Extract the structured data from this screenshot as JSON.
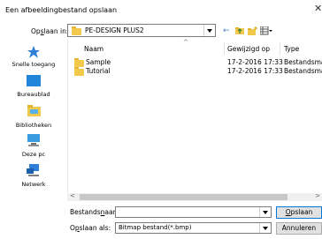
{
  "window": {
    "title": "Een afbeeldingbestand opslaan"
  },
  "toolbar": {
    "save_in_label_pre": "Op",
    "save_in_label_u": "s",
    "save_in_label_post": "laan in:",
    "location": "PE-DESIGN PLUS2"
  },
  "nav": [
    {
      "label": "Snelle toegang",
      "icon": "star-icon"
    },
    {
      "label": "Bureaublad",
      "icon": "desktop-icon"
    },
    {
      "label": "Bibliotheken",
      "icon": "library-icon"
    },
    {
      "label": "Deze pc",
      "icon": "computer-icon"
    },
    {
      "label": "Netwerk",
      "icon": "network-icon"
    }
  ],
  "list": {
    "headers": {
      "name": "Naam",
      "modified": "Gewijzigd op",
      "type": "Type"
    },
    "rows": [
      {
        "name": "Sample",
        "modified": "17-2-2016 17:33",
        "type": "Bestandsmap"
      },
      {
        "name": "Tutorial",
        "modified": "17-2-2016 17:33",
        "type": "Bestandsmap"
      }
    ]
  },
  "footer": {
    "filename_label_pre": "Bestands",
    "filename_label_u": "n",
    "filename_label_post": "aam:",
    "filename_value": "",
    "type_label_pre": "O",
    "type_label_u": "p",
    "type_label_post": "slaan als:",
    "type_value": "Bitmap bestand(*.bmp)",
    "save_pre": "",
    "save_u": "O",
    "save_post": "pslaan",
    "cancel_label": "Annuleren"
  }
}
